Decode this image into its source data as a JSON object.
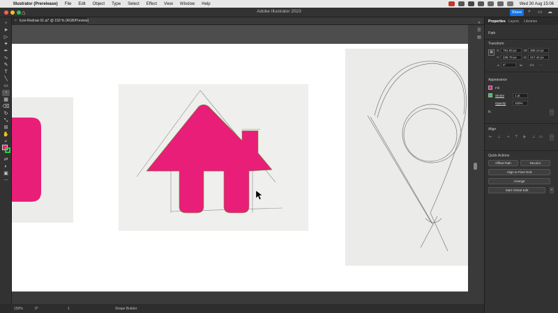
{
  "menubar": {
    "app": "Illustrator (Prerelease)",
    "items": [
      "File",
      "Edit",
      "Object",
      "Type",
      "Select",
      "Effect",
      "View",
      "Window",
      "Help"
    ],
    "clock": "Wed 30 Aug  15:06"
  },
  "titlebar": {
    "title": "Adobe Illustrator 2023",
    "share": "Share"
  },
  "document": {
    "tab": "Icon-Redraw 01.ai* @ 150 % (RGB/Preview)",
    "close": "×"
  },
  "colors": {
    "fill": "#e91e78",
    "stroke": "#2ecc40",
    "accent": "#1473e6"
  },
  "panel": {
    "tabs": [
      "Properties",
      "Layers",
      "Libraries"
    ],
    "selection_type": "Path",
    "transform": {
      "title": "Transform",
      "x_label": "X:",
      "x": "781.93 px",
      "y_label": "Y:",
      "y": "235.79 px",
      "w_label": "W:",
      "w": "280.14 px",
      "h_label": "H:",
      "h": "217.42 px",
      "angle": "0°",
      "shear": "1/4"
    },
    "appearance": {
      "title": "Appearance",
      "fill": "Fill",
      "stroke": "Stroke",
      "stroke_weight": "1 pt",
      "opacity": "Opacity",
      "opacity_value": "100%",
      "fx": "fx."
    },
    "align": {
      "title": "Align"
    },
    "quick_actions": {
      "title": "Quick Actions",
      "offset_path": "Offset Path",
      "recolor": "Recolor",
      "align_pixel": "Align to Pixel Grid",
      "arrange": "Arrange",
      "global_edit": "Start Global Edit"
    }
  },
  "status": {
    "zoom": "150%",
    "rotate": "0°",
    "artboard": "1",
    "tool": "Shape Builder"
  }
}
